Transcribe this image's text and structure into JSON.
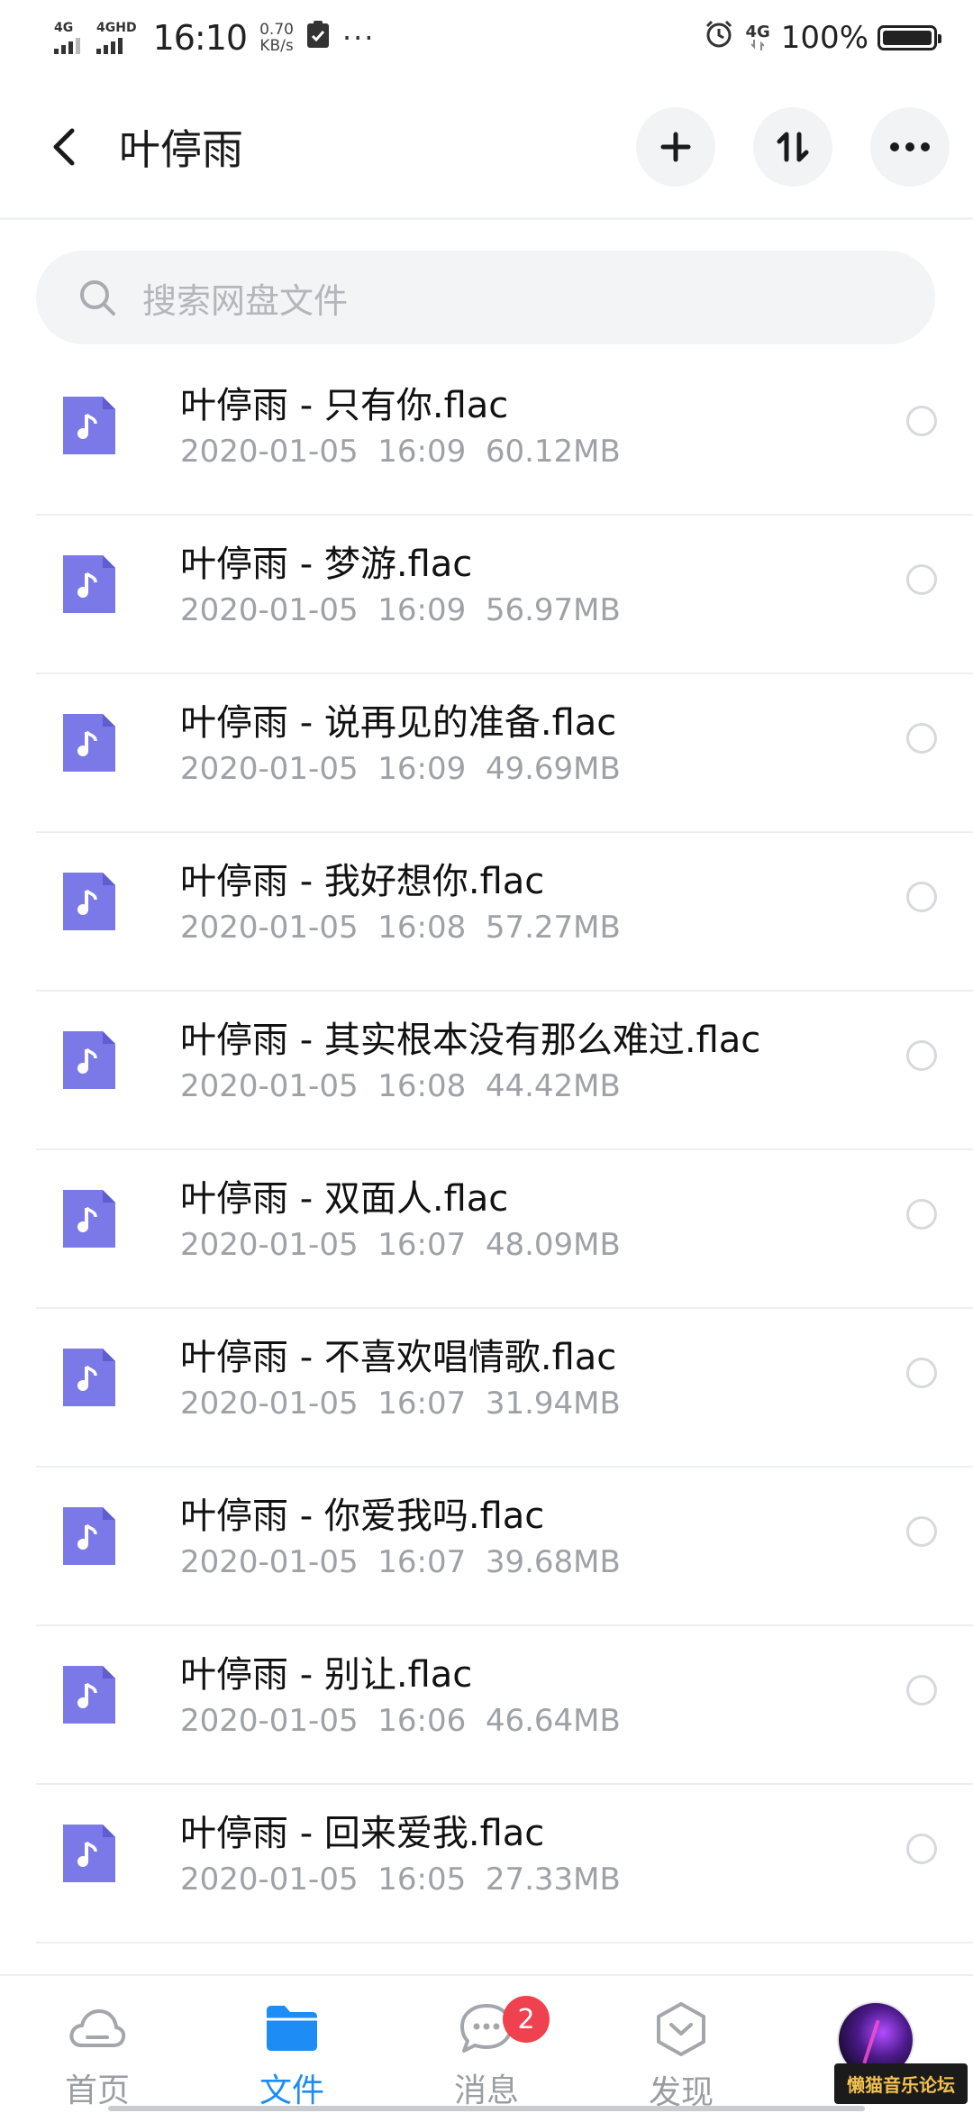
{
  "status_bar": {
    "signal1_label": "4G",
    "signal2_label": "4GHD",
    "time": "16:10",
    "speed_value": "0.70",
    "speed_unit": "KB/s",
    "dots": "···",
    "net_label": "4G",
    "battery_pct": "100%",
    "battery_level": 1.0
  },
  "header": {
    "title": "叶停雨"
  },
  "search": {
    "placeholder": "搜索网盘文件"
  },
  "files": [
    {
      "name": "叶停雨 - 只有你.flac",
      "date": "2020-01-05",
      "time": "16:09",
      "size": "60.12MB"
    },
    {
      "name": "叶停雨 - 梦游.flac",
      "date": "2020-01-05",
      "time": "16:09",
      "size": "56.97MB"
    },
    {
      "name": "叶停雨 - 说再见的准备.flac",
      "date": "2020-01-05",
      "time": "16:09",
      "size": "49.69MB"
    },
    {
      "name": "叶停雨 - 我好想你.flac",
      "date": "2020-01-05",
      "time": "16:08",
      "size": "57.27MB"
    },
    {
      "name": "叶停雨 - 其实根本没有那么难过.flac",
      "date": "2020-01-05",
      "time": "16:08",
      "size": "44.42MB"
    },
    {
      "name": "叶停雨 - 双面人.flac",
      "date": "2020-01-05",
      "time": "16:07",
      "size": "48.09MB"
    },
    {
      "name": "叶停雨 - 不喜欢唱情歌.flac",
      "date": "2020-01-05",
      "time": "16:07",
      "size": "31.94MB"
    },
    {
      "name": "叶停雨 - 你爱我吗.flac",
      "date": "2020-01-05",
      "time": "16:07",
      "size": "39.68MB"
    },
    {
      "name": "叶停雨 - 别让.flac",
      "date": "2020-01-05",
      "time": "16:06",
      "size": "46.64MB"
    },
    {
      "name": "叶停雨 - 回来爱我.flac",
      "date": "2020-01-05",
      "time": "16:05",
      "size": "27.33MB"
    }
  ],
  "bottom_nav": {
    "items": [
      {
        "label": "首页",
        "icon": "cloud-icon"
      },
      {
        "label": "文件",
        "icon": "folder-icon",
        "active": true
      },
      {
        "label": "消息",
        "icon": "chat-icon",
        "badge": "2"
      },
      {
        "label": "发现",
        "icon": "discover-icon"
      }
    ]
  },
  "watermark": "懒猫音乐论坛",
  "colors": {
    "accent": "#1e8cf5",
    "file_icon": "#7b79e8",
    "badge": "#f0414f"
  }
}
